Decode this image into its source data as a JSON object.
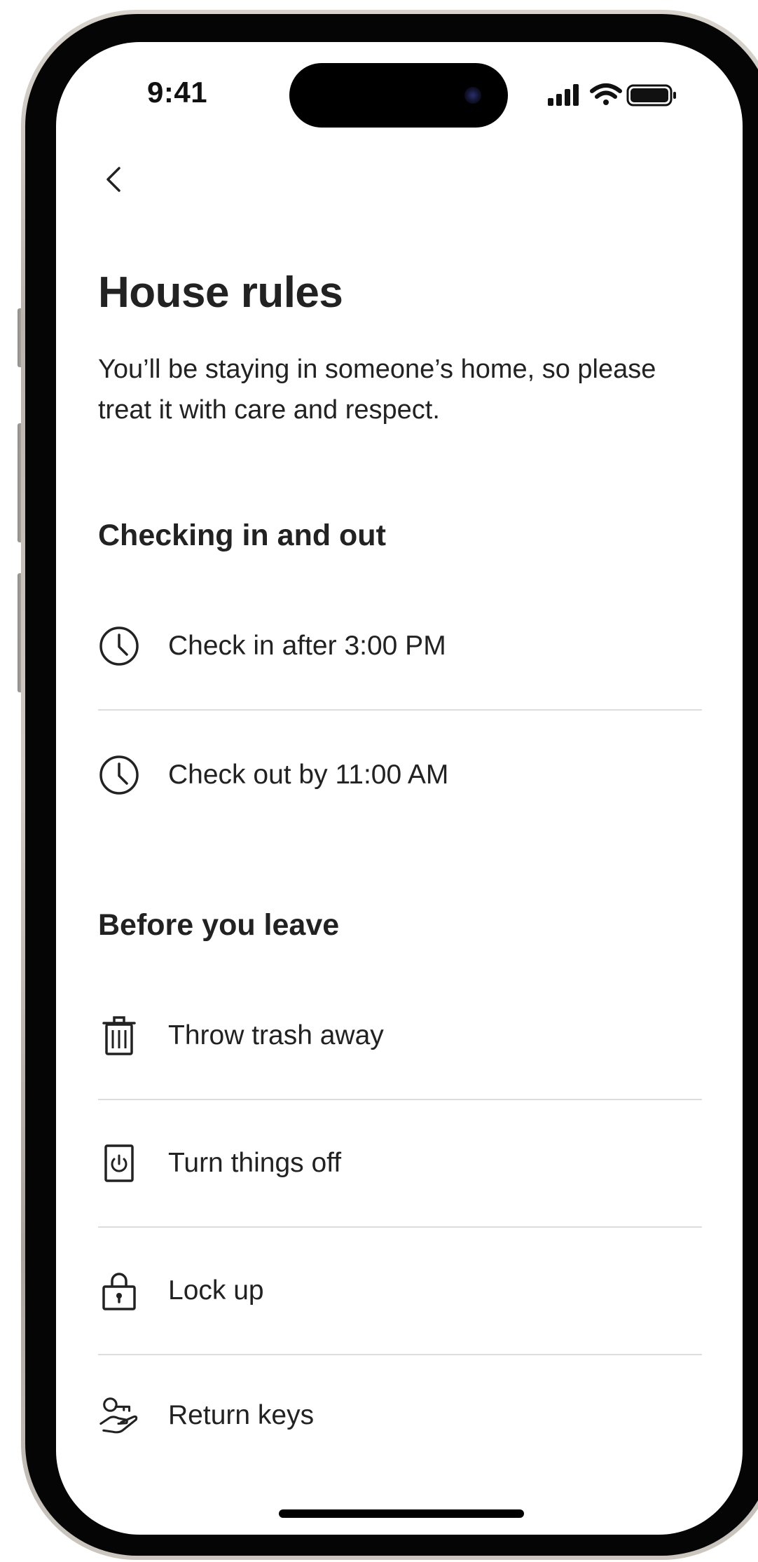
{
  "status_bar": {
    "time": "9:41",
    "icons": [
      "cellular-signal-icon",
      "wifi-icon",
      "battery-icon"
    ]
  },
  "nav": {
    "back_icon": "chevron-left-icon"
  },
  "page": {
    "title": "House rules",
    "subtitle": "You’ll be staying in someone’s home, so please treat it with care and respect."
  },
  "sections": [
    {
      "heading": "Checking in and out",
      "items": [
        {
          "icon": "clock-icon",
          "label": "Check in after 3:00 PM"
        },
        {
          "icon": "clock-icon",
          "label": "Check out by 11:00 AM"
        }
      ]
    },
    {
      "heading": "Before you leave",
      "items": [
        {
          "icon": "trash-icon",
          "label": "Throw trash away"
        },
        {
          "icon": "power-switch-icon",
          "label": "Turn things off"
        },
        {
          "icon": "lock-icon",
          "label": "Lock up"
        },
        {
          "icon": "hand-keys-icon",
          "label": "Return keys"
        }
      ]
    }
  ],
  "colors": {
    "text_primary": "#222222",
    "divider": "#dddddd",
    "background": "#ffffff"
  }
}
